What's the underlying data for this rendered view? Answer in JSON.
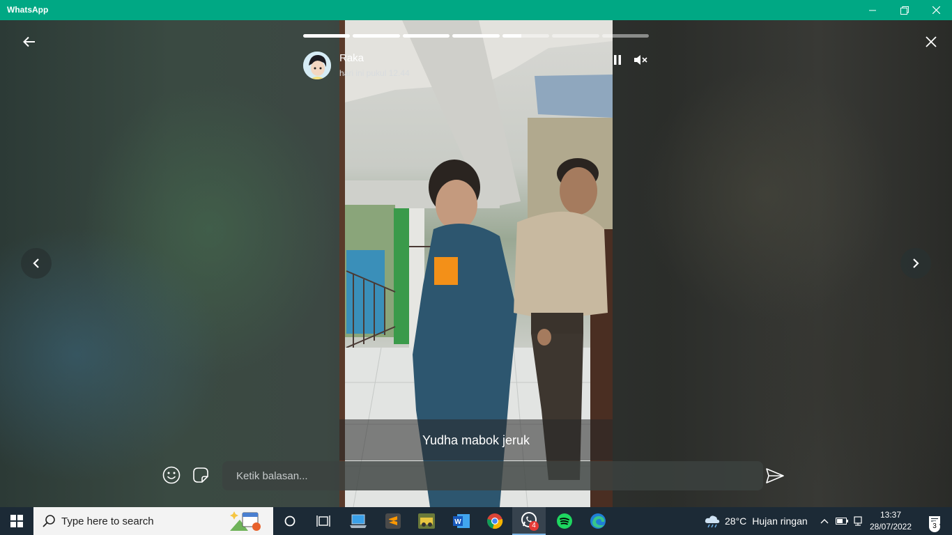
{
  "window": {
    "title": "WhatsApp"
  },
  "status": {
    "sender_name": "Raka",
    "time": "hari ini pukul 12.44",
    "caption": "Yudha mabok jeruk",
    "progress": [
      1,
      1,
      1,
      1,
      0.4,
      0,
      0
    ],
    "reply_placeholder": "Ketik balasan..."
  },
  "taskbar": {
    "search_placeholder": "Type here to search",
    "whatsapp_badge": "4",
    "weather_temp": "28°C",
    "weather_text": "Hujan ringan",
    "clock_time": "13:37",
    "clock_date": "28/07/2022",
    "notification_count": "3"
  },
  "colors": {
    "accent": "#00a884",
    "taskbar": "#1c2a36"
  }
}
